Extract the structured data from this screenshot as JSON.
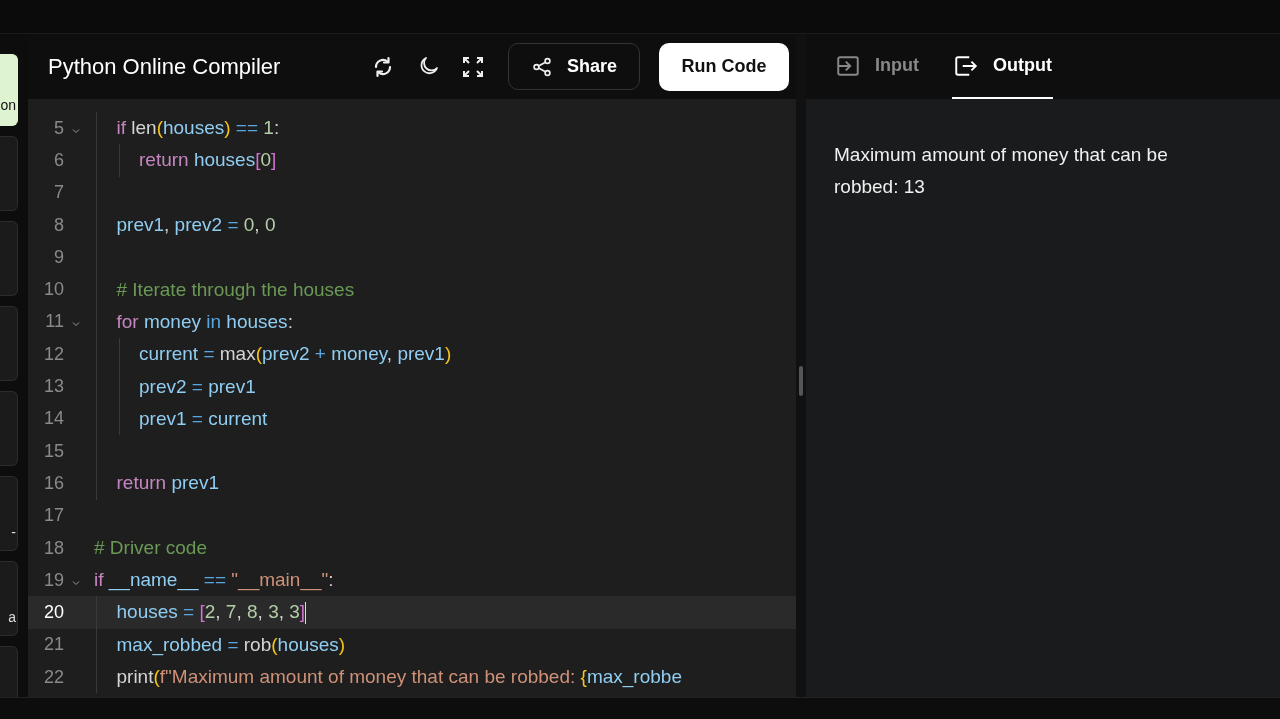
{
  "sidebar": {
    "items": [
      {
        "text": "on",
        "selected": true
      },
      {
        "selected": false
      },
      {
        "selected": false
      },
      {
        "selected": false
      },
      {
        "selected": false
      },
      {
        "text": "-",
        "selected": false
      },
      {
        "text": "a",
        "selected": false
      },
      {
        "selected": false
      }
    ]
  },
  "header": {
    "title": "Python Online Compiler",
    "share": "Share",
    "run": "Run Code"
  },
  "tabs": [
    {
      "label": "Input",
      "kind": "input",
      "selected": false
    },
    {
      "label": "Output",
      "kind": "output",
      "selected": true
    }
  ],
  "editor": {
    "lines": [
      {
        "children": [
          {
            "number": "5",
            "current": false,
            "expanded": true,
            "code": [
              {
                "text": "if",
                "kind": "keyword"
              },
              {
                "text": " len",
                "kind": "plain"
              },
              {
                "text": "(",
                "kind": "paren"
              },
              {
                "text": "houses",
                "kind": "var"
              },
              {
                "text": ")",
                "kind": "paren"
              },
              {
                "text": " ==",
                "kind": "op"
              },
              {
                "text": " 1",
                "kind": "num"
              },
              {
                "text": ":",
                "kind": "plain"
              }
            ],
            "children": [
              {
                "number": "6",
                "current": false,
                "code": [
                  {
                    "text": "return",
                    "kind": "keyword"
                  },
                  {
                    "text": " houses",
                    "kind": "var"
                  },
                  {
                    "text": "[",
                    "kind": "bracket"
                  },
                  {
                    "text": "0",
                    "kind": "num"
                  },
                  {
                    "text": "]",
                    "kind": "bracket"
                  }
                ]
              }
            ]
          },
          {
            "number": "7",
            "current": false
          },
          {
            "number": "8",
            "current": false,
            "code": [
              {
                "text": "prev1",
                "kind": "var"
              },
              {
                "text": ",",
                "kind": "plain"
              },
              {
                "text": " prev2",
                "kind": "var"
              },
              {
                "text": " =",
                "kind": "op"
              },
              {
                "text": " 0",
                "kind": "num"
              },
              {
                "text": ",",
                "kind": "plain"
              },
              {
                "text": " 0",
                "kind": "num"
              }
            ]
          },
          {
            "number": "9",
            "current": false
          },
          {
            "number": "10",
            "current": false,
            "code": [
              {
                "text": "# Iterate through the houses",
                "kind": "comment"
              }
            ]
          },
          {
            "number": "11",
            "current": false,
            "expanded": true,
            "code": [
              {
                "text": "for",
                "kind": "keyword"
              },
              {
                "text": " money",
                "kind": "var"
              },
              {
                "text": " in",
                "kind": "op"
              },
              {
                "text": " houses",
                "kind": "var"
              },
              {
                "text": ":",
                "kind": "plain"
              }
            ],
            "children": [
              {
                "number": "12",
                "current": false,
                "code": [
                  {
                    "text": "current",
                    "kind": "var"
                  },
                  {
                    "text": " =",
                    "kind": "op"
                  },
                  {
                    "text": " max",
                    "kind": "plain"
                  },
                  {
                    "text": "(",
                    "kind": "paren"
                  },
                  {
                    "text": "prev2",
                    "kind": "var"
                  },
                  {
                    "text": " +",
                    "kind": "op"
                  },
                  {
                    "text": " money",
                    "kind": "var"
                  },
                  {
                    "text": ",",
                    "kind": "plain"
                  },
                  {
                    "text": " prev1",
                    "kind": "var"
                  },
                  {
                    "text": ")",
                    "kind": "paren"
                  }
                ]
              },
              {
                "number": "13",
                "current": false,
                "code": [
                  {
                    "text": "prev2",
                    "kind": "var"
                  },
                  {
                    "text": " =",
                    "kind": "op"
                  },
                  {
                    "text": " prev1",
                    "kind": "var"
                  }
                ]
              },
              {
                "number": "14",
                "current": false,
                "code": [
                  {
                    "text": "prev1",
                    "kind": "var"
                  },
                  {
                    "text": " =",
                    "kind": "op"
                  },
                  {
                    "text": " current",
                    "kind": "var"
                  }
                ]
              }
            ]
          },
          {
            "number": "15",
            "current": false
          },
          {
            "number": "16",
            "current": false,
            "code": [
              {
                "text": "return",
                "kind": "keyword"
              },
              {
                "text": " prev1",
                "kind": "var"
              }
            ]
          }
        ]
      },
      {
        "number": "17",
        "current": false
      },
      {
        "number": "18",
        "current": false,
        "code": [
          {
            "text": "# Driver code",
            "kind": "comment"
          }
        ]
      },
      {
        "number": "19",
        "current": false,
        "expanded": true,
        "code": [
          {
            "text": "if",
            "kind": "keyword"
          },
          {
            "text": " __name__",
            "kind": "var"
          },
          {
            "text": " ==",
            "kind": "op"
          },
          {
            "text": " \"__main__\"",
            "kind": "string"
          },
          {
            "text": ":",
            "kind": "plain"
          }
        ],
        "children": [
          {
            "number": "20",
            "current": true,
            "code": [
              {
                "text": "houses",
                "kind": "var"
              },
              {
                "text": " =",
                "kind": "op"
              },
              {
                "text": " [",
                "kind": "bracket"
              },
              {
                "text": "2",
                "kind": "num"
              },
              {
                "text": ",",
                "kind": "plain"
              },
              {
                "text": " 7",
                "kind": "num"
              },
              {
                "text": ",",
                "kind": "plain"
              },
              {
                "text": " 8",
                "kind": "num"
              },
              {
                "text": ",",
                "kind": "plain"
              },
              {
                "text": " 3",
                "kind": "num"
              },
              {
                "text": ",",
                "kind": "plain"
              },
              {
                "text": " 3",
                "kind": "num"
              },
              {
                "text": "]",
                "kind": "bracket"
              }
            ]
          },
          {
            "number": "21",
            "current": false,
            "code": [
              {
                "text": "max_robbed",
                "kind": "var"
              },
              {
                "text": " =",
                "kind": "op"
              },
              {
                "text": " rob",
                "kind": "plain"
              },
              {
                "text": "(",
                "kind": "paren"
              },
              {
                "text": "houses",
                "kind": "var"
              },
              {
                "text": ")",
                "kind": "paren"
              }
            ]
          },
          {
            "number": "22",
            "current": false,
            "code": [
              {
                "text": "print",
                "kind": "plain"
              },
              {
                "text": "(",
                "kind": "paren"
              },
              {
                "text": "f\"Maximum amount of money that can be robbed: ",
                "kind": "string"
              },
              {
                "text": "{",
                "kind": "paren"
              },
              {
                "text": "max_robbe",
                "kind": "var"
              }
            ]
          }
        ]
      }
    ]
  },
  "output": {
    "text": "Maximum amount of money that can be robbed: 13"
  }
}
